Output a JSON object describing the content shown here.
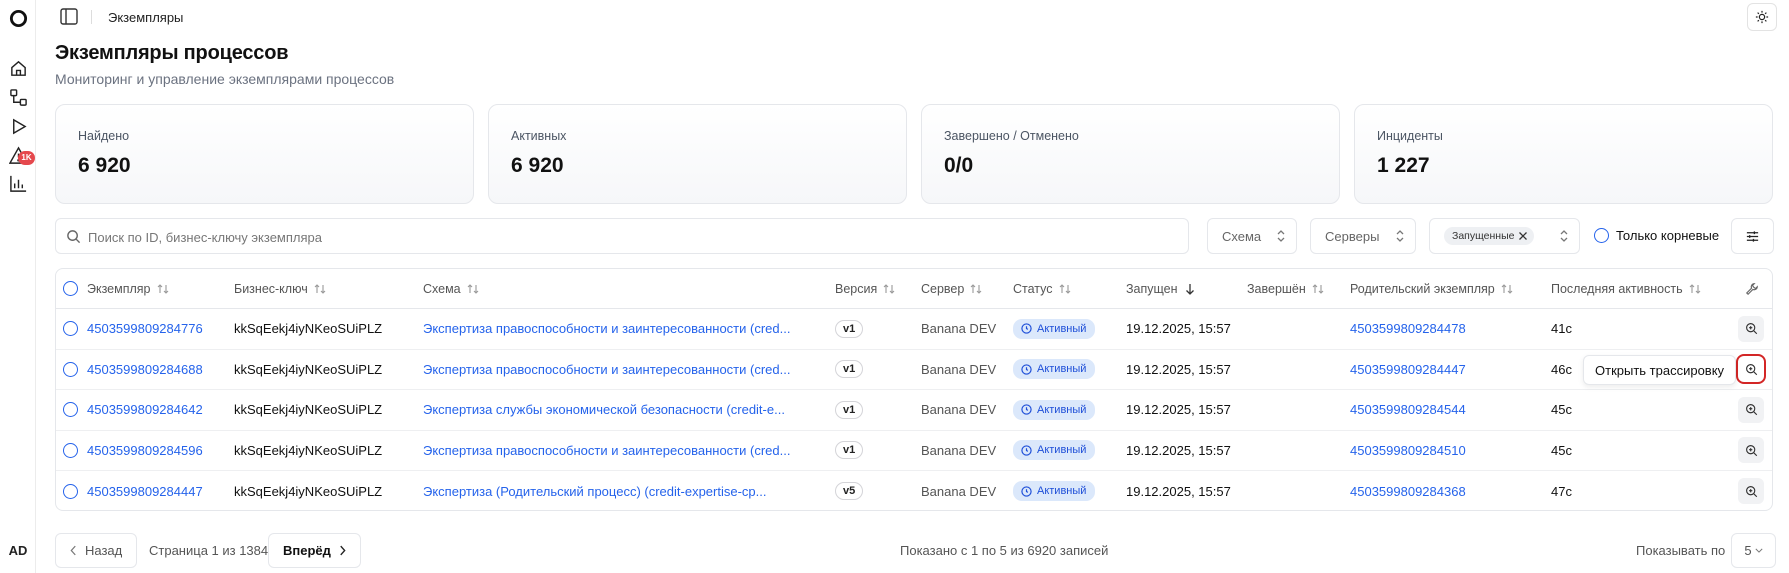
{
  "rail": {
    "logo_icon": "circle-logo-icon",
    "items": [
      "home-icon",
      "schemes-icon",
      "play-icon",
      "alert-icon",
      "chart-icon"
    ],
    "alerts_badge": "1K",
    "avatar": "AD"
  },
  "topbar": {
    "breadcrumb": "Экземпляры",
    "theme_icon": "sun-icon"
  },
  "page": {
    "title": "Экземпляры процессов",
    "subtitle": "Мониторинг и управление экземплярами процессов"
  },
  "stats": [
    {
      "label": "Найдено",
      "value": "6 920"
    },
    {
      "label": "Активных",
      "value": "6 920"
    },
    {
      "label": "Завершено / Отменено",
      "value": "0/0"
    },
    {
      "label": "Инциденты",
      "value": "1 227"
    }
  ],
  "filters": {
    "search_placeholder": "Поиск по ID, бизнес-ключу экземпляра",
    "scheme": "Схема",
    "servers": "Серверы",
    "status_chip": "Запущенные",
    "root_only": "Только корневые"
  },
  "table": {
    "headers": {
      "instance": "Экземпляр",
      "business_key": "Бизнес-ключ",
      "scheme": "Схема",
      "version": "Версия",
      "server": "Сервер",
      "status": "Статус",
      "started": "Запущен",
      "finished": "Завершён",
      "parent": "Родительский экземпляр",
      "last_activity": "Последняя активность"
    },
    "rows": [
      {
        "instance": "4503599809284776",
        "business_key": "kkSqEekj4iyNKeoSUiPLZ",
        "scheme": "Экспертиза правоспособности и заинтересованности (cred...",
        "version": "v1",
        "server": "Banana DEV",
        "status": "Активный",
        "started": "19.12.2025, 15:57",
        "finished": "",
        "parent": "4503599809284478",
        "last_activity": "41с"
      },
      {
        "instance": "4503599809284688",
        "business_key": "kkSqEekj4iyNKeoSUiPLZ",
        "scheme": "Экспертиза правоспособности и заинтересованности (cred...",
        "version": "v1",
        "server": "Banana DEV",
        "status": "Активный",
        "started": "19.12.2025, 15:57",
        "finished": "",
        "parent": "4503599809284447",
        "last_activity": "46с"
      },
      {
        "instance": "4503599809284642",
        "business_key": "kkSqEekj4iyNKeoSUiPLZ",
        "scheme": "Экспертиза службы экономической безопасности (credit-e...",
        "version": "v1",
        "server": "Banana DEV",
        "status": "Активный",
        "started": "19.12.2025, 15:57",
        "finished": "",
        "parent": "4503599809284544",
        "last_activity": "45с"
      },
      {
        "instance": "4503599809284596",
        "business_key": "kkSqEekj4iyNKeoSUiPLZ",
        "scheme": "Экспертиза правоспособности и заинтересованности (cred...",
        "version": "v1",
        "server": "Banana DEV",
        "status": "Активный",
        "started": "19.12.2025, 15:57",
        "finished": "",
        "parent": "4503599809284510",
        "last_activity": "45с"
      },
      {
        "instance": "4503599809284447",
        "business_key": "kkSqEekj4iyNKeoSUiPLZ",
        "scheme": "Экспертиза (Родительский процесс) (credit-expertise-cp...",
        "version": "v5",
        "server": "Banana DEV",
        "status": "Активный",
        "started": "19.12.2025, 15:57",
        "finished": "",
        "parent": "4503599809284368",
        "last_activity": "47с"
      }
    ],
    "tooltip": "Открыть трассировку"
  },
  "pagination": {
    "back": "Назад",
    "page_info": "Страница 1 из 1384",
    "next": "Вперёд",
    "shown": "Показано с 1 по 5 из 6920 записей",
    "per_page_label": "Показывать по",
    "per_page_value": "5"
  },
  "colors": {
    "accent": "#2563eb",
    "status_bg": "#dbe8fb",
    "badge": "#e5484d",
    "highlight": "#d32626"
  }
}
